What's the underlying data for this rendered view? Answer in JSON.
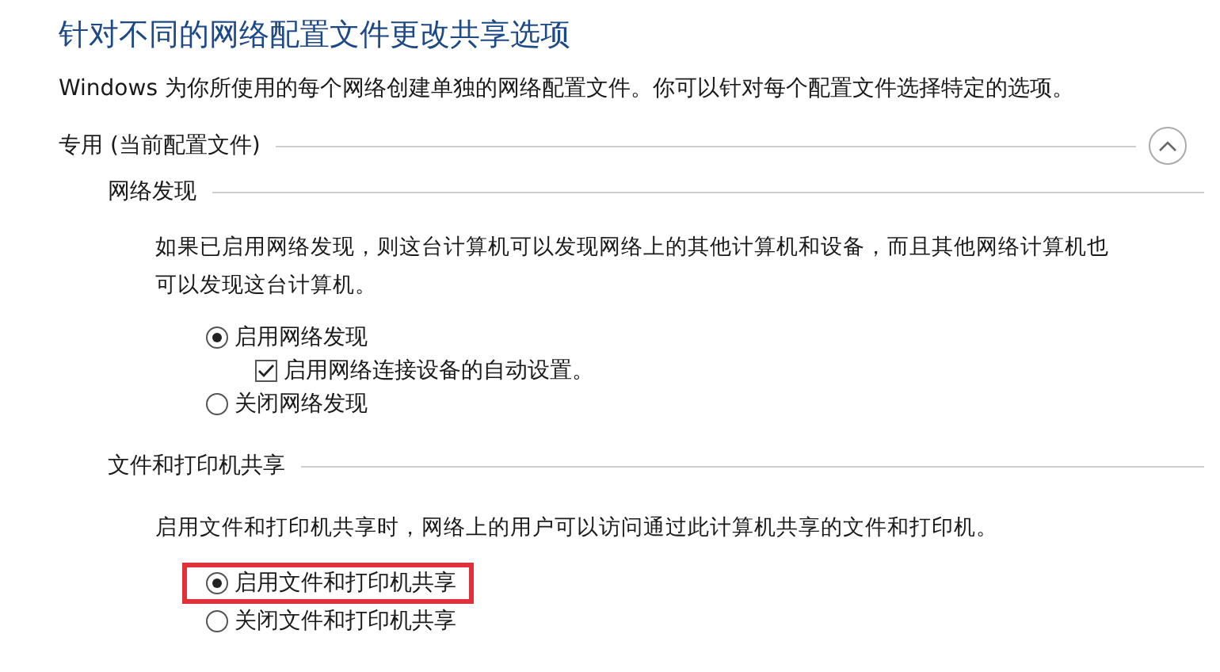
{
  "title": "针对不同的网络配置文件更改共享选项",
  "description": "Windows 为你所使用的每个网络创建单独的网络配置文件。你可以针对每个配置文件选择特定的选项。",
  "profile": {
    "label": "专用 (当前配置文件)",
    "expanded": true
  },
  "sections": [
    {
      "heading": "网络发现",
      "description": "如果已启用网络发现，则这台计算机可以发现网络上的其他计算机和设备，而且其他网络计算机也可以发现这台计算机。",
      "options": [
        {
          "kind": "radio",
          "label": "启用网络发现",
          "selected": true,
          "highlighted": false,
          "children": [
            {
              "kind": "checkbox",
              "label": "启用网络连接设备的自动设置。",
              "checked": true
            }
          ]
        },
        {
          "kind": "radio",
          "label": "关闭网络发现",
          "selected": false,
          "highlighted": false
        }
      ]
    },
    {
      "heading": "文件和打印机共享",
      "description": "启用文件和打印机共享时，网络上的用户可以访问通过此计算机共享的文件和打印机。",
      "options": [
        {
          "kind": "radio",
          "label": "启用文件和打印机共享",
          "selected": true,
          "highlighted": true
        },
        {
          "kind": "radio",
          "label": "关闭文件和打印机共享",
          "selected": false,
          "highlighted": false
        }
      ]
    }
  ]
}
